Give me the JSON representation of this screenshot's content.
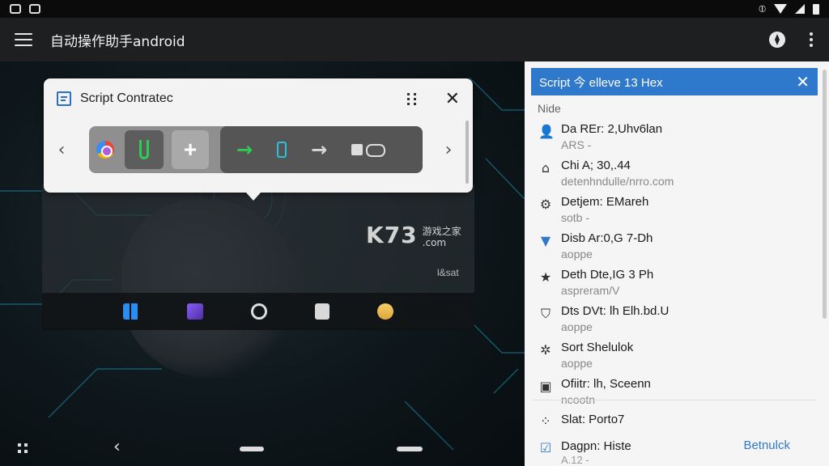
{
  "app_bar": {
    "title": "自动操作助手android"
  },
  "floating_panel": {
    "title": "Script Contratec"
  },
  "watermark": {
    "big": "K73",
    "small_top": "游戏之家",
    "small_bottom": ".com",
    "label": "l&sat"
  },
  "side_panel": {
    "title": "Script 今 elleve 13 Hex",
    "section_label": "Nide",
    "items": [
      {
        "icon": "person-icon",
        "title": "Da REr: 2,Uhv6lan",
        "subtitle": "ARS -"
      },
      {
        "icon": "home-icon",
        "title": "Chi A; 30,.44",
        "subtitle": "detenhndulle/nrro.com"
      },
      {
        "icon": "gear-icon",
        "title": "Detjem: EMareh",
        "subtitle": "sotb -"
      },
      {
        "icon": "shield-icon",
        "title": "Disb Ar:0,G 7-Dh",
        "subtitle": "aoppe"
      },
      {
        "icon": "star-icon",
        "title": "Deth Dte,IG 3 Ph",
        "subtitle": "aspreram/V"
      },
      {
        "icon": "shield-outline-icon",
        "title": "Dts DVt: lh Elh.bd.U",
        "subtitle": "aoppe"
      },
      {
        "icon": "gear-outline-icon",
        "title": "Sort Shelulok",
        "subtitle": "aoppe"
      },
      {
        "icon": "briefcase-icon",
        "title": "Ofiitr: lh, Sceenn",
        "subtitle": "ncootn"
      }
    ],
    "bottom_item": {
      "title": "Slat: Porto7"
    },
    "footer_item": {
      "title": "Dagpn: Histe",
      "subtitle": "A.12 -",
      "link": "Betnulck"
    }
  }
}
